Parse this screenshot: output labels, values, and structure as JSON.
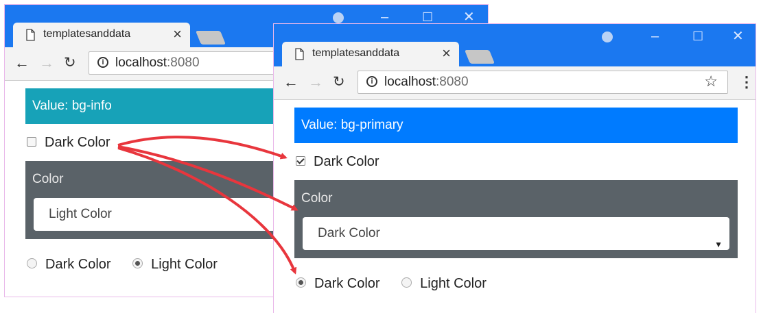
{
  "windows": [
    {
      "tab_title": "templatesanddata",
      "tab_close": "×",
      "url_host": "localhost",
      "url_port": ":8080",
      "value_text": "Value: bg-info",
      "value_color": "#17a2b8",
      "checkbox_label": "Dark Color",
      "checkbox_checked": false,
      "panel_label": "Color",
      "select_value": "Light Color",
      "radio_options": [
        "Dark Color",
        "Light Color"
      ],
      "radio_selected": "Light Color"
    },
    {
      "tab_title": "templatesanddata",
      "tab_close": "×",
      "url_host": "localhost",
      "url_port": ":8080",
      "value_text": "Value: bg-primary",
      "value_color": "#007bff",
      "checkbox_label": "Dark Color",
      "checkbox_checked": true,
      "panel_label": "Color",
      "select_value": "Dark Color",
      "radio_options": [
        "Dark Color",
        "Light Color"
      ],
      "radio_selected": "Dark Color"
    }
  ],
  "icons": {
    "back": "back-arrow-icon",
    "forward": "forward-arrow-icon",
    "reload": "reload-icon",
    "info": "info-icon",
    "star": "star-icon",
    "menu": "menu-icon",
    "page": "page-icon",
    "profile": "profile-icon",
    "minimize": "minimize-icon",
    "maximize": "maximize-icon",
    "close": "close-icon"
  },
  "colors": {
    "titlebar": "#1b78f0",
    "panel": "#5a6268",
    "annotation_arrow": "#e8363d"
  }
}
